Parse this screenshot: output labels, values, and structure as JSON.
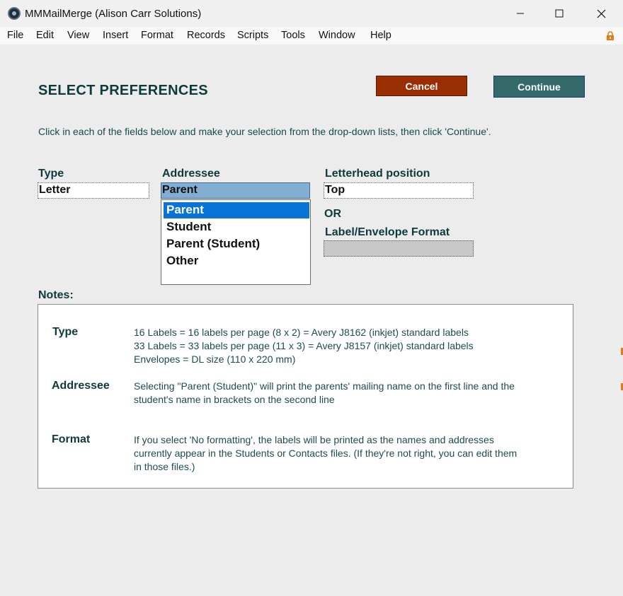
{
  "window": {
    "title": "MMMailMerge (Alison Carr Solutions)",
    "controls": [
      "minimize",
      "maximize",
      "close"
    ]
  },
  "menu": {
    "items": [
      "File",
      "Edit",
      "View",
      "Insert",
      "Format",
      "Records",
      "Scripts",
      "Tools",
      "Window",
      "Help"
    ]
  },
  "page": {
    "title": "SELECT PREFERENCES",
    "instructions": "Click in each of the fields below and make your selection from the drop-down lists, then click 'Continue'.",
    "cancel_label": "Cancel",
    "continue_label": "Continue"
  },
  "fields": {
    "type_label": "Type",
    "type_value": "Letter",
    "addressee_label": "Addressee",
    "addressee_value": "Parent",
    "letterhead_label": "Letterhead position",
    "letterhead_value": "Top",
    "or_label": "OR",
    "format_label": "Label/Envelope Format",
    "format_value": ""
  },
  "dropdown": {
    "options": [
      "Parent",
      "Student",
      "Parent (Student)",
      "Other"
    ],
    "selected": "Parent"
  },
  "notes": {
    "label": "Notes:",
    "type_head": "Type",
    "type_lines": [
      "16 Labels = 16 labels per page (8 x 2) = Avery J8162 (inkjet) standard labels",
      "33 Labels = 33 labels per page (11 x 3) = Avery J8157 (inkjet) standard labels",
      "Envelopes = DL size (110 x 220 mm)"
    ],
    "addressee_head": "Addressee",
    "addressee_lines": [
      "Selecting \"Parent (Student)\" will print the parents' mailing name on the first line and the",
      "student's name in brackets on the second line"
    ],
    "format_head": "Format",
    "format_lines": [
      "If you select 'No formatting', the labels will be printed as the names and addresses",
      "currently appear in the Students or Contacts files.  (If they're not right, you can edit them",
      "in those files.)"
    ]
  },
  "colors": {
    "cancel_bg": "#9a2e03",
    "continue_bg": "#356a6b",
    "heading_text": "#0e3a3d",
    "selected_option_bg": "#0a73d8",
    "addressee_field_bg": "#82aed4"
  },
  "icons": {
    "app": "mmmailmerge-app-icon",
    "lock": "lock-icon"
  }
}
